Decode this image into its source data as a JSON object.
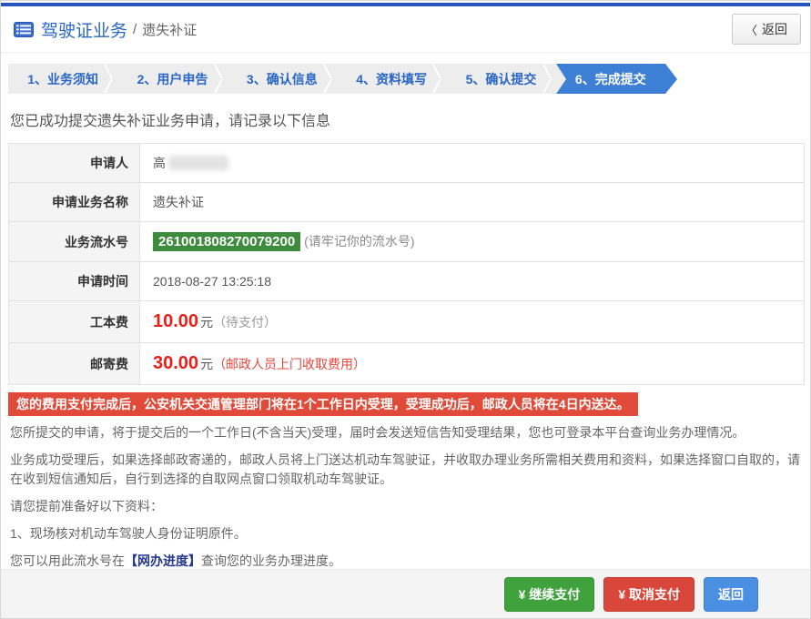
{
  "header": {
    "title": "驾驶证业务",
    "separator": "/",
    "subtitle": "遗失补证",
    "back_chevron": "〈",
    "back_label": "返回"
  },
  "steps": [
    {
      "label": "1、业务须知",
      "active": false
    },
    {
      "label": "2、用户申告",
      "active": false
    },
    {
      "label": "3、确认信息",
      "active": false
    },
    {
      "label": "4、资料填写",
      "active": false
    },
    {
      "label": "5、确认提交",
      "active": false
    },
    {
      "label": "6、完成提交",
      "active": true
    }
  ],
  "success_message": "您已成功提交遗失补证业务申请，请记录以下信息",
  "info_table": {
    "rows": [
      {
        "label": "申请人",
        "value": "高",
        "redacted": true
      },
      {
        "label": "申请业务名称",
        "value": "遗失补证"
      },
      {
        "label": "业务流水号",
        "serial": "261001808270079200",
        "note": "(请牢记你的流水号)"
      },
      {
        "label": "申请时间",
        "value": "2018-08-27 13:25:18"
      },
      {
        "label": "工本费",
        "amount": "10.00",
        "unit": "元",
        "note": "（待支付）"
      },
      {
        "label": "邮寄费",
        "amount": "30.00",
        "unit": "元",
        "note": "（邮政人员上门收取费用）"
      }
    ]
  },
  "alert_banner": "您的费用支付完成后，公安机关交通管理部门将在1个工作日内受理，受理成功后，邮政人员将在4日内送达。",
  "notes": [
    "您所提交的申请，将于提交后的一个工作日(不含当天)受理，届时会发送短信告知受理结果，您也可登录本平台查询业务办理情况。",
    "业务成功受理后，如果选择邮政寄递的，邮政人员将上门送达机动车驾驶证，并收取办理业务所需相关费用和资料，如果选择窗口自取的，请在收到短信通知后，自行到选择的自取网点窗口领取机动车驾驶证。",
    "请您提前准备好以下资料：",
    "1、现场核对机动车驾驶人身份证明原件。"
  ],
  "progress_line": {
    "prefix": "您可以用此流水号在",
    "link": "【网办进度】",
    "suffix": "查询您的业务办理进度。"
  },
  "footer": {
    "continue_pay": "¥ 继续支付",
    "cancel_pay": "¥ 取消支付",
    "back": "返回"
  },
  "colors": {
    "accent_blue": "#2a66c5",
    "step_active_blue": "#3e7fd6",
    "serial_green": "#3d8b3d",
    "fee_red": "#e9201a",
    "banner_red": "#e04a38",
    "button_green": "#3fa23c",
    "button_red": "#d9473b",
    "button_blue": "#4a8fe2",
    "link_navy": "#24388c"
  }
}
